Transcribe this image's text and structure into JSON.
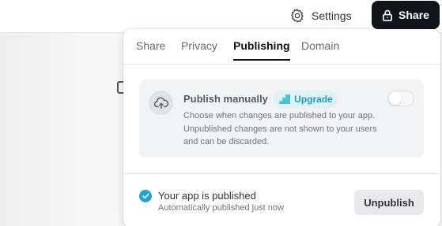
{
  "header": {
    "settings_label": "Settings",
    "share_label": "Share"
  },
  "panel": {
    "tabs": [
      {
        "label": "Share",
        "active": false
      },
      {
        "label": "Privacy",
        "active": false
      },
      {
        "label": "Publishing",
        "active": true
      },
      {
        "label": "Domain",
        "active": false
      }
    ],
    "publish_card": {
      "title": "Publish manually",
      "badge": "Upgrade",
      "description": "Choose when changes are published to your app. Unpublished changes are not shown to your users and can be discarded.",
      "toggle_on": false
    },
    "status": {
      "title": "Your app is published",
      "subtitle": "Automatically published just now",
      "unpublish_label": "Unpublish"
    }
  },
  "colors": {
    "accent": "#1aa5d6",
    "badge_text": "#1aa1bf",
    "share_button_bg": "#111418"
  },
  "icons": {
    "settings": "gear-icon",
    "share": "lock-icon",
    "publish": "cloud-upload-icon",
    "upgrade": "upgrade-stairs-icon",
    "status": "check-circle-icon"
  }
}
